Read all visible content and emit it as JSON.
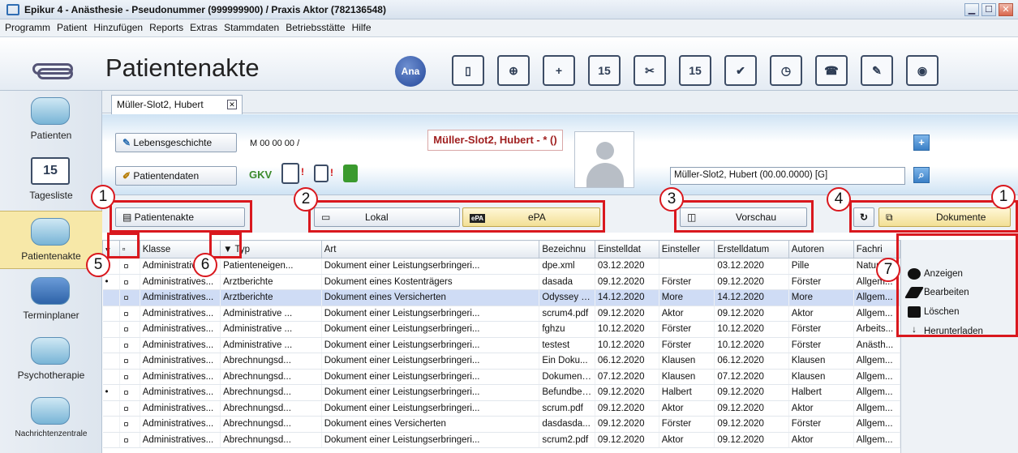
{
  "window": {
    "title": "Epikur 4 - Anästhesie - Pseudonummer (999999900) / Praxis Aktor (782136548)",
    "minimize": "▁",
    "maximize": "☐",
    "close": "✕"
  },
  "menu": [
    "Programm",
    "Patient",
    "Hinzufügen",
    "Reports",
    "Extras",
    "Stammdaten",
    "Betriebsstätte",
    "Hilfe"
  ],
  "toolbar": {
    "module_title": "Patientenakte",
    "ana_badge": "Ana",
    "icons": [
      "card-reader-icon",
      "add-patients-icon",
      "add-person-icon",
      "calendar-search-icon",
      "tools-icon",
      "calendar-list-icon",
      "checklist-icon",
      "clock-list-icon",
      "phone-list-icon",
      "edit-form-icon",
      "camera-icon"
    ],
    "icon_glyphs": [
      "▯",
      "⊕",
      "+",
      "15",
      "✂",
      "15",
      "✔",
      "◷",
      "☎",
      "✎",
      "◉"
    ]
  },
  "sidebar": [
    {
      "label": "Patienten"
    },
    {
      "label": "Tagesliste",
      "badge": "15"
    },
    {
      "label": "Patientenakte",
      "active": true
    },
    {
      "label": "Terminplaner"
    },
    {
      "label": "Psychotherapie"
    },
    {
      "label": "Nachrichtenzentrale"
    }
  ],
  "tab": {
    "label": "Müller-Slot2, Hubert",
    "close": "✕"
  },
  "patient": {
    "lebensgeschichte": "Lebensgeschichte",
    "id_text": "M 00 00 00 /",
    "patientendaten": "Patientendaten",
    "insurance": "GKV",
    "name_banner": "Müller-Slot2, Hubert - * ()",
    "search_value": "Müller-Slot2, Hubert (00.00.0000) [G]"
  },
  "buttons": {
    "patientenakte": "Patientenakte",
    "lokal": "Lokal",
    "epa": "ePA",
    "vorschau": "Vorschau",
    "dokumente": "Dokumente",
    "epa_icon": "ePA"
  },
  "callouts": [
    "1",
    "2",
    "3",
    "4",
    "1",
    "5",
    "6",
    "7"
  ],
  "table": {
    "columns": [
      "",
      "",
      "Klasse",
      "Typ",
      "Art",
      "Bezeichnu",
      "Einstelldat",
      "Einsteller",
      "Erstelldatum",
      "Autoren",
      "Fachri"
    ],
    "rows": [
      {
        "m": "",
        "c1": "Administratives...",
        "c2": "Patienteneigen...",
        "c3": "Dokument einer Leistungserbringeri...",
        "c4": "dpe.xml",
        "c5": "03.12.2020",
        "c6": "",
        "c7": "03.12.2020",
        "c8": "Pille",
        "c9": "Naturh"
      },
      {
        "m": "•",
        "c1": "Administratives...",
        "c2": "Arztberichte",
        "c3": "Dokument eines Kostenträgers",
        "c4": "dasada",
        "c5": "09.12.2020",
        "c6": "Förster",
        "c7": "09.12.2020",
        "c8": "Förster",
        "c9": "Allgem..."
      },
      {
        "m": "",
        "c1": "Administratives...",
        "c2": "Arztberichte",
        "c3": "Dokument eines Versicherten",
        "c4": "Odyssey G...",
        "c5": "14.12.2020",
        "c6": "More",
        "c7": "14.12.2020",
        "c8": "More",
        "c9": "Allgem...",
        "sel": true
      },
      {
        "m": "",
        "c1": "Administratives...",
        "c2": "Administrative ...",
        "c3": "Dokument einer Leistungserbringeri...",
        "c4": "scrum4.pdf",
        "c5": "09.12.2020",
        "c6": "Aktor",
        "c7": "09.12.2020",
        "c8": "Aktor",
        "c9": "Allgem..."
      },
      {
        "m": "",
        "c1": "Administratives...",
        "c2": "Administrative ...",
        "c3": "Dokument einer Leistungserbringeri...",
        "c4": "fghzu",
        "c5": "10.12.2020",
        "c6": "Förster",
        "c7": "10.12.2020",
        "c8": "Förster",
        "c9": "Arbeits..."
      },
      {
        "m": "",
        "c1": "Administratives...",
        "c2": "Administrative ...",
        "c3": "Dokument einer Leistungserbringeri...",
        "c4": "testest",
        "c5": "10.12.2020",
        "c6": "Förster",
        "c7": "10.12.2020",
        "c8": "Förster",
        "c9": "Anästh..."
      },
      {
        "m": "",
        "c1": "Administratives...",
        "c2": "Abrechnungsd...",
        "c3": "Dokument einer Leistungserbringeri...",
        "c4": "Ein Doku...",
        "c5": "06.12.2020",
        "c6": "Klausen",
        "c7": "06.12.2020",
        "c8": "Klausen",
        "c9": "Allgem..."
      },
      {
        "m": "",
        "c1": "Administratives...",
        "c2": "Abrechnungsd...",
        "c3": "Dokument einer Leistungserbringeri...",
        "c4": "Dokument ...",
        "c5": "07.12.2020",
        "c6": "Klausen",
        "c7": "07.12.2020",
        "c8": "Klausen",
        "c9": "Allgem..."
      },
      {
        "m": "•",
        "c1": "Administratives...",
        "c2": "Abrechnungsd...",
        "c3": "Dokument einer Leistungserbringeri...",
        "c4": "Befundberi...",
        "c5": "09.12.2020",
        "c6": "Halbert",
        "c7": "09.12.2020",
        "c8": "Halbert",
        "c9": "Allgem..."
      },
      {
        "m": "",
        "c1": "Administratives...",
        "c2": "Abrechnungsd...",
        "c3": "Dokument einer Leistungserbringeri...",
        "c4": "scrum.pdf",
        "c5": "09.12.2020",
        "c6": "Aktor",
        "c7": "09.12.2020",
        "c8": "Aktor",
        "c9": "Allgem..."
      },
      {
        "m": "",
        "c1": "Administratives...",
        "c2": "Abrechnungsd...",
        "c3": "Dokument eines Versicherten",
        "c4": "dasdasda...",
        "c5": "09.12.2020",
        "c6": "Förster",
        "c7": "09.12.2020",
        "c8": "Förster",
        "c9": "Allgem..."
      },
      {
        "m": "",
        "c1": "Administratives...",
        "c2": "Abrechnungsd...",
        "c3": "Dokument einer Leistungserbringeri...",
        "c4": "scrum2.pdf",
        "c5": "09.12.2020",
        "c6": "Aktor",
        "c7": "09.12.2020",
        "c8": "Aktor",
        "c9": "Allgem..."
      }
    ]
  },
  "actions": [
    {
      "label": "Anzeigen",
      "icon": "eye-icon"
    },
    {
      "label": "Bearbeiten",
      "icon": "pencil-icon"
    },
    {
      "label": "Löschen",
      "icon": "trash-icon"
    },
    {
      "label": "Herunterladen",
      "icon": "download-icon"
    }
  ]
}
